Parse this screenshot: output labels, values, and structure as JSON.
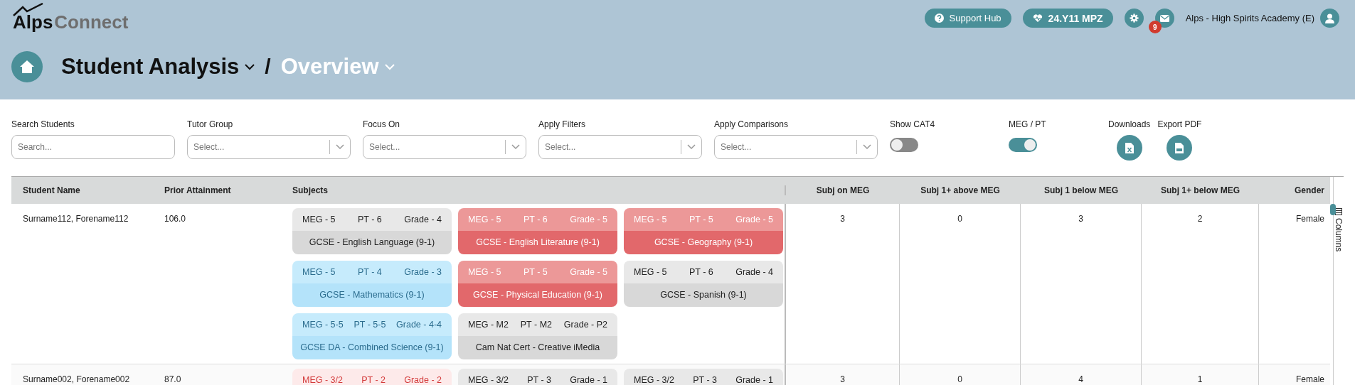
{
  "header": {
    "logo": {
      "part_1": "Alps",
      "part_2": "Connect"
    },
    "support_button": "Support Hub",
    "cohort_button": "24.Y11 MPZ",
    "message_count": "9",
    "school": "Alps - High Spirits Academy (E)",
    "breadcrumb": [
      "Student Analysis",
      "Overview"
    ],
    "separator": "/"
  },
  "filters": [
    {
      "kind": "search",
      "label": "Search Students",
      "placeholder": "Search..."
    },
    {
      "kind": "select",
      "label": "Tutor Group",
      "placeholder": "Select..."
    },
    {
      "kind": "select",
      "label": "Focus On",
      "placeholder": "Select..."
    },
    {
      "kind": "select",
      "label": "Apply Filters",
      "placeholder": "Select..."
    },
    {
      "kind": "select",
      "label": "Apply Comparisons",
      "placeholder": "Select..."
    },
    {
      "kind": "toggle",
      "label": "Show CAT4",
      "on": false
    },
    {
      "kind": "toggle",
      "label": "MEG / PT",
      "on": true
    }
  ],
  "downloads": {
    "label": "Downloads",
    "export_label": "Export PDF"
  },
  "table": {
    "columns": [
      "Student Name",
      "Prior Attainment",
      "Subjects",
      "Subj on MEG",
      "Subj 1+ above MEG",
      "Subj 1 below MEG",
      "Subj 1+ below MEG",
      "Gender"
    ],
    "rows": [
      {
        "name": "Surname112, Forename112",
        "prior": "106.0",
        "on_meg": "3",
        "above": "0",
        "below": "3",
        "below_more": "2",
        "gender": "Female",
        "subjects": [
          {
            "kind": "grey",
            "meg": "MEG - 5",
            "pt": "PT - 6",
            "grade": "Grade - 4",
            "subject": "GCSE - English Language (9-1)"
          },
          {
            "kind": "red",
            "meg": "MEG - 5",
            "pt": "PT - 6",
            "grade": "Grade - 5",
            "subject": "GCSE - English Literature (9-1)"
          },
          {
            "kind": "red",
            "meg": "MEG - 5",
            "pt": "PT - 5",
            "grade": "Grade - 5",
            "subject": "GCSE - Geography (9-1)"
          },
          {
            "kind": "blue",
            "meg": "MEG - 5",
            "pt": "PT - 4",
            "grade": "Grade - 3",
            "subject": "GCSE - Mathematics (9-1)"
          },
          {
            "kind": "red",
            "meg": "MEG - 5",
            "pt": "PT - 5",
            "grade": "Grade - 5",
            "subject": "GCSE - Physical Education (9-1)"
          },
          {
            "kind": "grey",
            "meg": "MEG - 5",
            "pt": "PT - 6",
            "grade": "Grade - 4",
            "subject": "GCSE - Spanish (9-1)"
          },
          {
            "kind": "blue",
            "meg": "MEG - 5-5",
            "pt": "PT - 5-5",
            "grade": "Grade - 4-4",
            "subject": "GCSE DA - Combined Science (9-1)"
          },
          {
            "kind": "grey",
            "meg": "MEG - M2",
            "pt": "PT - M2",
            "grade": "Grade - P2",
            "subject": "Cam Nat Cert - Creative iMedia"
          }
        ]
      },
      {
        "name": "Surname002, Forename002",
        "prior": "87.0",
        "on_meg": "3",
        "above": "0",
        "below": "4",
        "below_more": "1",
        "gender": "Female",
        "subjects": [
          {
            "kind": "pink",
            "meg": "MEG - 3/2",
            "pt": "PT - 2",
            "grade": "Grade - 2"
          },
          {
            "kind": "grey",
            "meg": "MEG - 3/2",
            "pt": "PT - 3",
            "grade": "Grade - 1"
          },
          {
            "kind": "grey",
            "meg": "MEG - 3/2",
            "pt": "PT - 3",
            "grade": "Grade - 1"
          }
        ]
      }
    ]
  },
  "columns_panel": "Columns"
}
